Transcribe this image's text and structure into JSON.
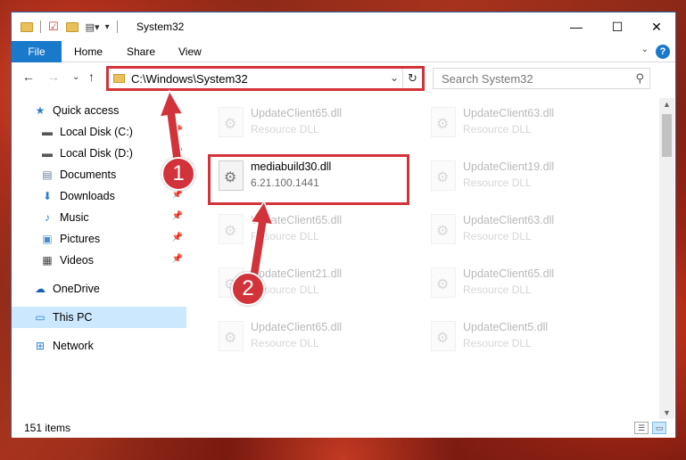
{
  "window": {
    "title": "System32",
    "controls": {
      "minimize": "—",
      "maximize": "☐",
      "close": "✕"
    }
  },
  "ribbon": {
    "tabs": [
      "File",
      "Home",
      "Share",
      "View"
    ],
    "collapse_icon": "chevron-down-icon",
    "help_label": "?"
  },
  "navigation": {
    "address": "C:\\Windows\\System32",
    "search_placeholder": "Search System32"
  },
  "sidebar": {
    "items": [
      {
        "label": "Quick access",
        "icon": "star-icon",
        "pinned": false
      },
      {
        "label": "Local Disk (C:)",
        "icon": "drive-icon",
        "pinned": true
      },
      {
        "label": "Local Disk (D:)",
        "icon": "drive-icon",
        "pinned": true
      },
      {
        "label": "Documents",
        "icon": "document-icon",
        "pinned": true
      },
      {
        "label": "Downloads",
        "icon": "download-icon",
        "pinned": true
      },
      {
        "label": "Music",
        "icon": "music-icon",
        "pinned": true
      },
      {
        "label": "Pictures",
        "icon": "picture-icon",
        "pinned": true
      },
      {
        "label": "Videos",
        "icon": "video-icon",
        "pinned": true
      },
      {
        "label": "OneDrive",
        "icon": "cloud-icon",
        "pinned": false
      },
      {
        "label": "This PC",
        "icon": "computer-icon",
        "pinned": false,
        "selected": true
      },
      {
        "label": "Network",
        "icon": "network-icon",
        "pinned": false
      }
    ]
  },
  "files": [
    {
      "name": "UpdateClient65.dll",
      "type": "Resource DLL",
      "faded": true
    },
    {
      "name": "UpdateClient63.dll",
      "type": "Resource DLL",
      "faded": true
    },
    {
      "name": "mediabuild30.dll",
      "type": "6.21.100.1441",
      "faded": false,
      "highlighted": true
    },
    {
      "name": "UpdateClient19.dll",
      "type": "Resource DLL",
      "faded": true
    },
    {
      "name": "UpdateClient65.dll",
      "type": "Resource DLL",
      "faded": true
    },
    {
      "name": "UpdateClient63.dll",
      "type": "Resource DLL",
      "faded": true
    },
    {
      "name": "UpdateClient21.dll",
      "type": "Resource DLL",
      "faded": true
    },
    {
      "name": "UpdateClient65.dll",
      "type": "Resource DLL",
      "faded": true
    },
    {
      "name": "UpdateClient65.dll",
      "type": "Resource DLL",
      "faded": true
    },
    {
      "name": "UpdateClient5.dll",
      "type": "Resource DLL",
      "faded": true
    }
  ],
  "status": {
    "item_count": "151 items"
  },
  "annotations": {
    "step1": "1",
    "step2": "2",
    "color": "#d2333a"
  }
}
